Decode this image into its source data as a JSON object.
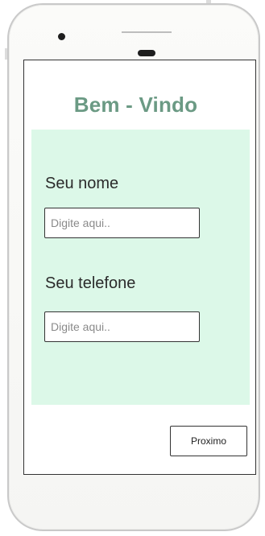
{
  "header": {
    "title": "Bem - Vindo"
  },
  "form": {
    "name_label": "Seu nome",
    "name_placeholder": "Digite aqui..",
    "phone_label": "Seu telefone",
    "phone_placeholder": "Digite aqui.."
  },
  "actions": {
    "next_label": "Proximo"
  },
  "colors": {
    "title": "#6b9a84",
    "panel_background": "#dcf8e8",
    "device_frame": "#c9c9c9"
  }
}
